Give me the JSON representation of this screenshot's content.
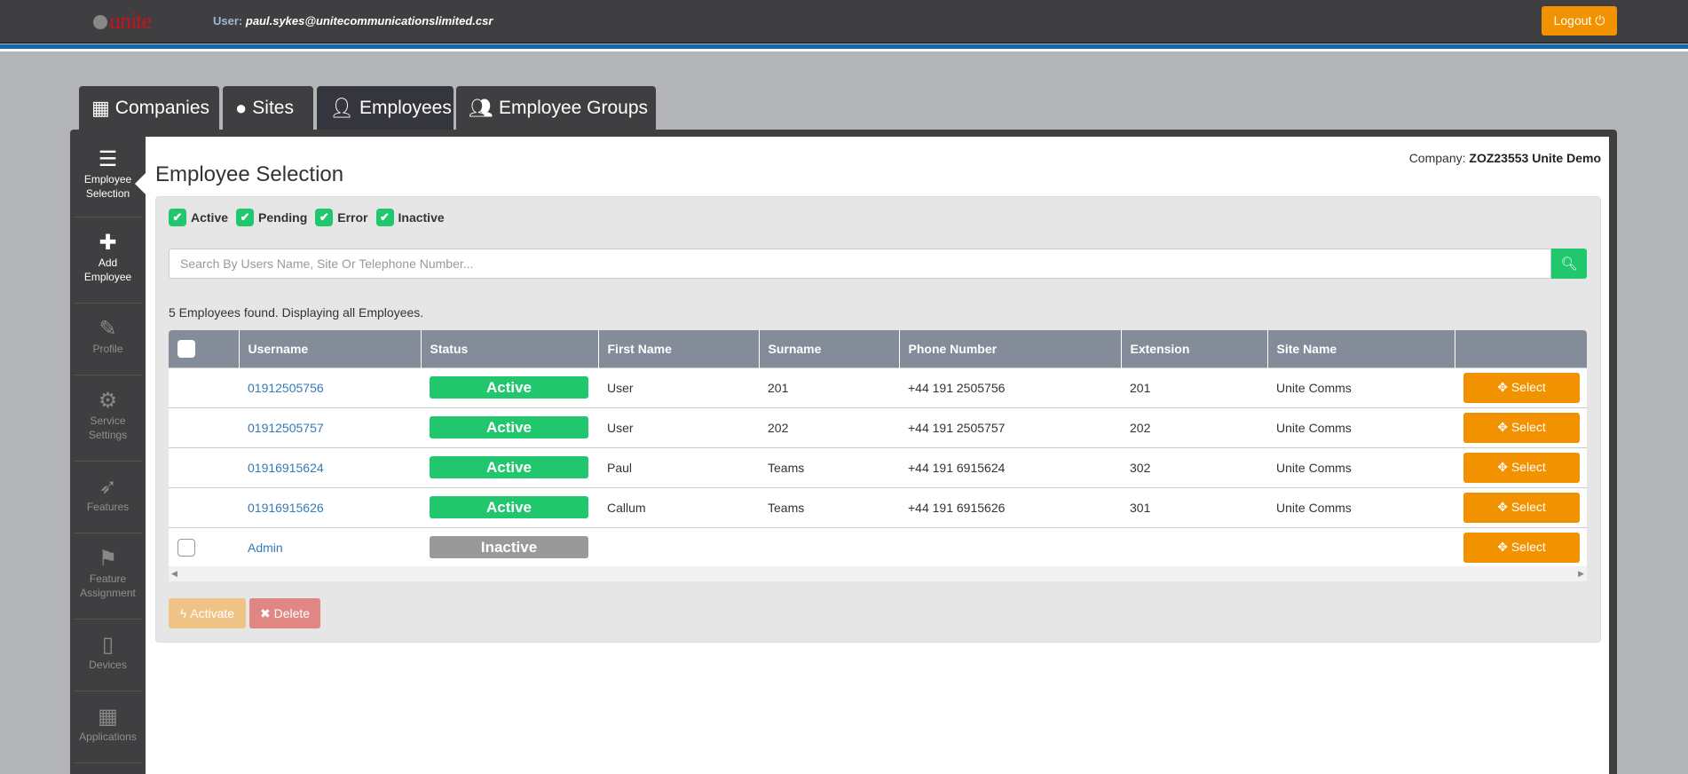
{
  "header": {
    "logo_text": "unite",
    "user_label": "User:",
    "user_email": "paul.sykes@unitecommunicationslimited.csr",
    "logout_label": "Logout",
    "logout_icon": "power-icon"
  },
  "tabs": [
    {
      "label": "Companies",
      "icon": "building-icon"
    },
    {
      "label": "Sites",
      "icon": "globe-icon"
    },
    {
      "label": "Employees",
      "icon": "user-icon",
      "active": true
    },
    {
      "label": "Employee Groups",
      "icon": "users-icon"
    }
  ],
  "sidebar": [
    {
      "label1": "Employee",
      "label2": "Selection",
      "icon": "list-icon",
      "active": true
    },
    {
      "label1": "Add",
      "label2": "Employee",
      "icon": "plus-icon"
    },
    {
      "label1": "Profile",
      "label2": "",
      "icon": "edit-icon"
    },
    {
      "label1": "Service",
      "label2": "Settings",
      "icon": "gear-icon"
    },
    {
      "label1": "Features",
      "label2": "",
      "icon": "rocket-icon"
    },
    {
      "label1": "Feature",
      "label2": "Assignment",
      "icon": "flag-icon"
    },
    {
      "label1": "Devices",
      "label2": "",
      "icon": "tablet-icon"
    },
    {
      "label1": "Applications",
      "label2": "",
      "icon": "grid-icon"
    }
  ],
  "page": {
    "title": "Employee Selection",
    "company_label": "Company:",
    "company_name": "ZOZ23553 Unite Demo"
  },
  "filters": [
    {
      "label": "Active",
      "checked": true
    },
    {
      "label": "Pending",
      "checked": true
    },
    {
      "label": "Error",
      "checked": true
    },
    {
      "label": "Inactive",
      "checked": true
    }
  ],
  "search": {
    "placeholder": "Search By Users Name, Site Or Telephone Number...",
    "value": ""
  },
  "count_text": "5 Employees found. Displaying all Employees.",
  "table": {
    "columns": [
      "",
      "Username",
      "Status",
      "First Name",
      "Surname",
      "Phone Number",
      "Extension",
      "Site Name",
      ""
    ],
    "rows": [
      {
        "username": "01912505756",
        "status": "Active",
        "first": "User",
        "surname": "201",
        "phone": "+44 191 2505756",
        "ext": "201",
        "site": "Unite Comms",
        "checkbox": false
      },
      {
        "username": "01912505757",
        "status": "Active",
        "first": "User",
        "surname": "202",
        "phone": "+44 191 2505757",
        "ext": "202",
        "site": "Unite Comms",
        "checkbox": false
      },
      {
        "username": "01916915624",
        "status": "Active",
        "first": "Paul",
        "surname": "Teams",
        "phone": "+44 191 6915624",
        "ext": "302",
        "site": "Unite Comms",
        "checkbox": false
      },
      {
        "username": "01916915626",
        "status": "Active",
        "first": "Callum",
        "surname": "Teams",
        "phone": "+44 191 6915626",
        "ext": "301",
        "site": "Unite Comms",
        "checkbox": false
      },
      {
        "username": "Admin",
        "status": "Inactive",
        "first": "",
        "surname": "",
        "phone": "",
        "ext": "",
        "site": "",
        "checkbox": true
      }
    ],
    "select_label": "Select"
  },
  "actions": {
    "activate": "Activate",
    "delete": "Delete"
  },
  "colors": {
    "active": "#21c76c",
    "inactive": "#999999",
    "accent": "#f39200",
    "header": "#3f3f42",
    "table_header": "#858c99"
  }
}
